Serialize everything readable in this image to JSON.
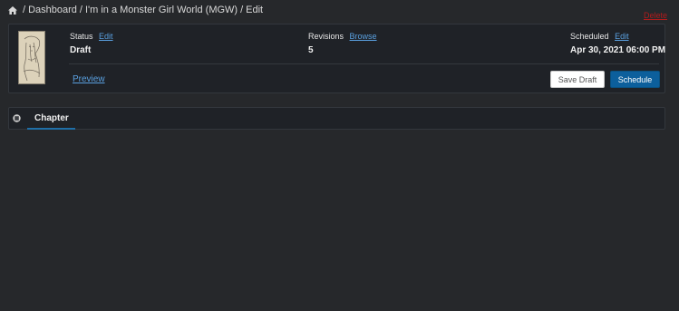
{
  "breadcrumb": {
    "home_icon": "home-icon",
    "items": [
      "Dashboard",
      "I'm in a Monster Girl World (MGW)",
      "Edit"
    ]
  },
  "delete_label": "Delete",
  "post": {
    "status_label": "Status",
    "status_edit": "Edit",
    "status_value": "Draft",
    "revisions_label": "Revisions",
    "revisions_browse": "Browse",
    "revisions_value": "5",
    "scheduled_label": "Scheduled",
    "scheduled_edit": "Edit",
    "scheduled_value": "Apr 30, 2021 06:00 PM",
    "preview_label": "Preview",
    "save_draft_label": "Save Draft",
    "schedule_label": "Schedule"
  },
  "tabs": [
    {
      "label": "Chapter",
      "active": true
    }
  ],
  "colors": {
    "background": "#26282b",
    "panel": "#1f2227",
    "link": "#5aa0e0",
    "delete": "#b01c1c",
    "primary_button": "#0c5f9c",
    "tab_underline": "#1f6fa8"
  }
}
